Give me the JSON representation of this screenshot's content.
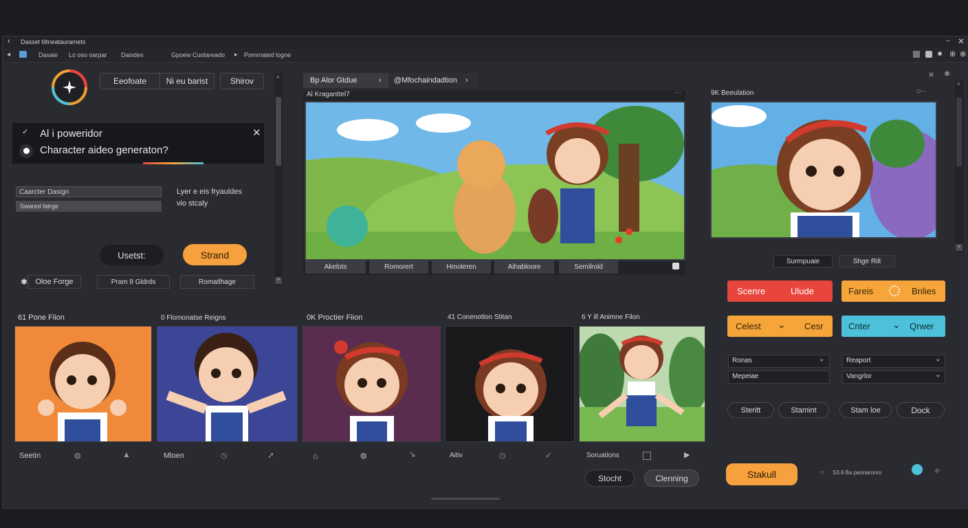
{
  "window": {
    "title": "Dasset tiltneatauramets"
  },
  "menubar": {
    "items": [
      "Dasaie",
      "Lo oso oarpar",
      "Daisdes",
      "Gpoew Cuotareado",
      "Pommated logne"
    ]
  },
  "left_panel": {
    "tabs": [
      "Eeofoate",
      "Ni eu barist",
      "Shirov"
    ],
    "popup": {
      "line1": "Al i poweridor",
      "line2": "Character aideo generaton?"
    },
    "field1": "Caarcter Dasign",
    "field2": "Swared fatrge",
    "desc1": "Lyer e eis fryauldes",
    "desc2": "vio stcaly",
    "btn_secondary": "Usetst:",
    "btn_primary": "Strand",
    "foot1": "Oloe Forge",
    "foot2": "Pram 8 Gldrds",
    "foot3": "Romatlhage"
  },
  "center_panel": {
    "breadcrumb1": "Bp Alor Gtdue",
    "breadcrumb2": "@Mfochaindadtion",
    "title": "Al Kraganttel7",
    "tabs": [
      "Akelots",
      "Romorert",
      "Hmoleren",
      "Aihabloore",
      "Semilrold"
    ]
  },
  "right_preview": {
    "title": "9K Beeulation",
    "btn1": "Surmpuaie",
    "btn2": "Shge Rilt"
  },
  "controls": {
    "row1": {
      "a": "Scenre",
      "b": "Ulude",
      "c": "Fareis",
      "d": "Bnlies"
    },
    "row2": {
      "a": "Celest",
      "b": "Cesr",
      "c": "Cnter",
      "d": "Qrwer"
    },
    "select1": "Ronas",
    "select2": "Mepeiae",
    "select3": "Reaport",
    "select4": "Vangrlor",
    "pills": [
      "Steritt",
      "Stamint",
      "Stam loe",
      "Dock"
    ],
    "primary": "Stakull",
    "status": "S3.6 Ba paonaronrs"
  },
  "gallery": {
    "items": [
      {
        "title": "61 Pone Flion",
        "foot": "Seetin"
      },
      {
        "title": "0 Flomonatse Reigns",
        "foot": "Mloen"
      },
      {
        "title": "0K Proctier Fiion",
        "foot": ""
      },
      {
        "title": "41 Conenotlon Stitan",
        "foot": "Aitiv"
      },
      {
        "title": "6 Y ill Animne Filon",
        "foot": "Soruations"
      }
    ],
    "btn1": "Stocht",
    "btn2": "Clenning"
  },
  "colors": {
    "red": "#e8453c",
    "orange": "#f5a53a",
    "blue": "#4dc1d9",
    "orange_btn": "#f6a13e"
  }
}
